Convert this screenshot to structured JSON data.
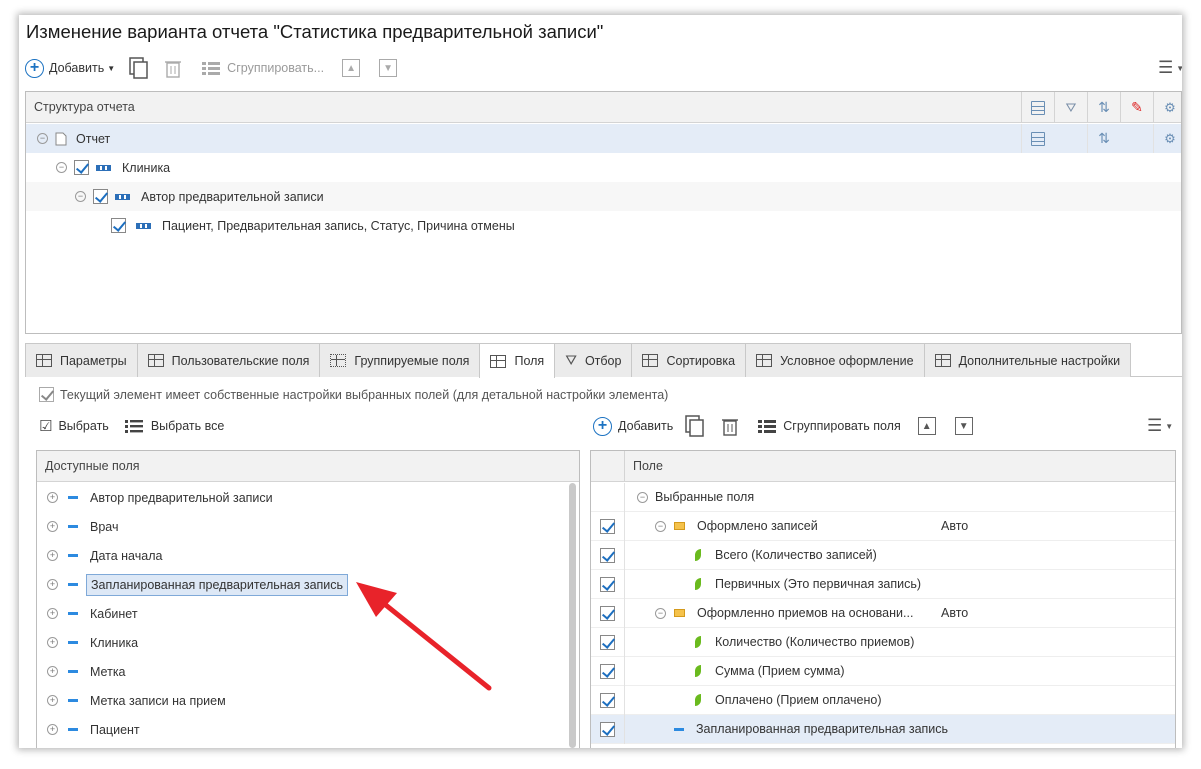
{
  "window": {
    "title": "Изменение варианта отчета \"Статистика предварительной записи\""
  },
  "top_toolbar": {
    "add_label": "Добавить",
    "group_label": "Сгруппировать..."
  },
  "structure": {
    "header": "Структура отчета",
    "rows": [
      {
        "label": "Отчет"
      },
      {
        "label": "Клиника"
      },
      {
        "label": "Автор предварительной записи"
      },
      {
        "label": "Пациент, Предварительная запись, Статус, Причина отмены"
      }
    ]
  },
  "tabs": [
    {
      "label": "Параметры"
    },
    {
      "label": "Пользовательские поля"
    },
    {
      "label": "Группируемые поля"
    },
    {
      "label": "Поля"
    },
    {
      "label": "Отбор"
    },
    {
      "label": "Сортировка"
    },
    {
      "label": "Условное оформление"
    },
    {
      "label": "Дополнительные настройки"
    }
  ],
  "own_settings_label": "Текущий элемент имеет собственные настройки выбранных полей (для детальной настройки элемента)",
  "left": {
    "select_label": "Выбрать",
    "select_all_label": "Выбрать все",
    "header": "Доступные поля",
    "items": [
      {
        "label": "Автор предварительной записи"
      },
      {
        "label": "Врач"
      },
      {
        "label": "Дата начала"
      },
      {
        "label": "Запланированная предварительная запись"
      },
      {
        "label": "Кабинет"
      },
      {
        "label": "Клиника"
      },
      {
        "label": "Метка"
      },
      {
        "label": "Метка записи на прием"
      },
      {
        "label": "Пациент"
      }
    ]
  },
  "right": {
    "add_label": "Добавить",
    "group_label": "Сгруппировать поля",
    "header": "Поле",
    "rows": [
      {
        "label": "Выбранные поля",
        "value": ""
      },
      {
        "label": "Оформлено записей",
        "value": "Авто"
      },
      {
        "label": "Всего (Количество записей)",
        "value": ""
      },
      {
        "label": "Первичных (Это первичная запись)",
        "value": ""
      },
      {
        "label": "Оформленно приемов на основани...",
        "value": "Авто"
      },
      {
        "label": "Количество (Количество приемов)",
        "value": ""
      },
      {
        "label": "Сумма (Прием сумма)",
        "value": ""
      },
      {
        "label": "Оплачено (Прием оплачено)",
        "value": ""
      },
      {
        "label": "Запланированная предварительная запись",
        "value": ""
      }
    ]
  },
  "colors": {
    "accent": "#1d73c2",
    "arrow": "#e8232a"
  }
}
